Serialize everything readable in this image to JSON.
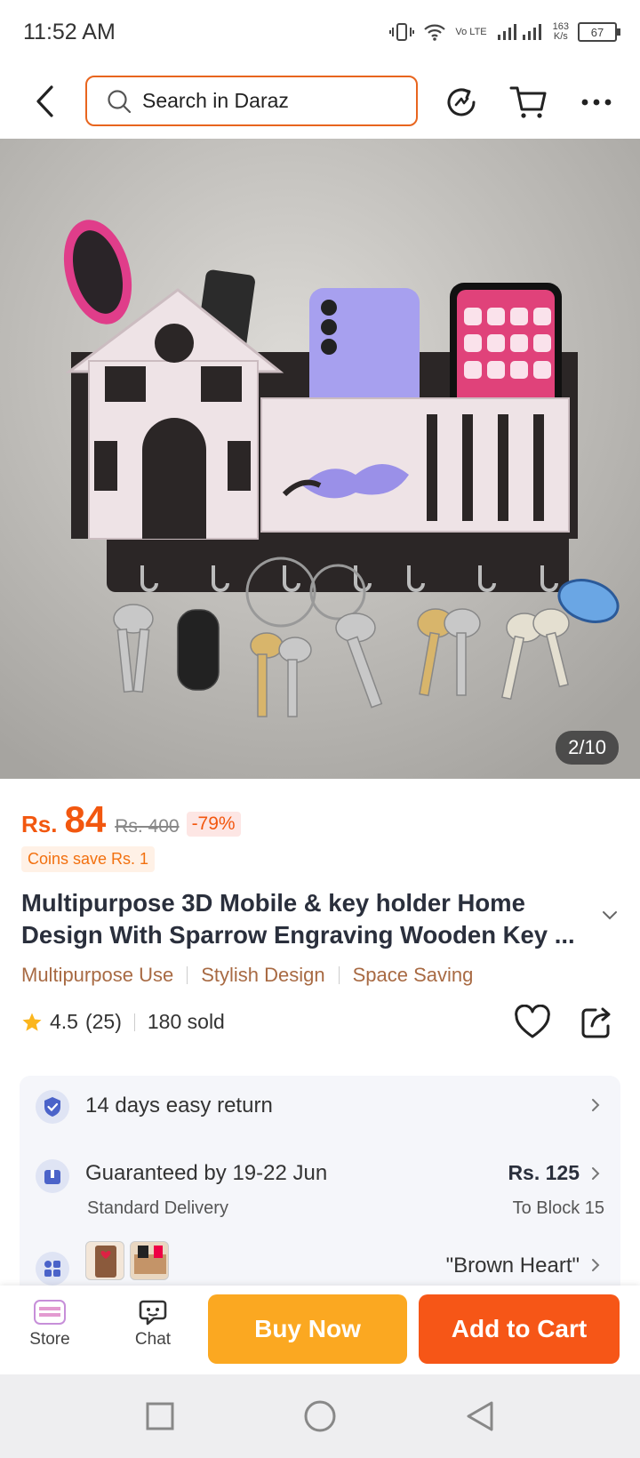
{
  "status": {
    "time": "11:52 AM",
    "network_label": "Vo LTE",
    "speed_value": "163",
    "speed_unit": "K/s",
    "battery": "67"
  },
  "header": {
    "search_placeholder": "Search in Daraz"
  },
  "gallery": {
    "counter": "2/10"
  },
  "product": {
    "currency": "Rs.",
    "price": "84",
    "old_price": "Rs. 400",
    "discount": "-79%",
    "coins": "Coins save Rs. 1",
    "title": "Multipurpose 3D Mobile & key holder Home Design With Sparrow Engraving Wooden Key ...",
    "tags": [
      "Multipurpose Use",
      "Stylish Design",
      "Space Saving"
    ],
    "rating": "4.5",
    "rating_count": "(25)",
    "sold": "180 sold"
  },
  "services": {
    "return": "14 days easy return",
    "delivery_main": "Guaranteed by 19-22 Jun",
    "delivery_sub": "Standard Delivery",
    "delivery_price": "Rs. 125",
    "delivery_location": "To Block 15",
    "variant": "\"Brown Heart\""
  },
  "actions": {
    "store": "Store",
    "chat": "Chat",
    "buy_now": "Buy Now",
    "add_to_cart": "Add to Cart"
  },
  "colors": {
    "accent_orange": "#f65617",
    "buy_yellow": "#fba821",
    "tag_brown": "#a86a43"
  }
}
